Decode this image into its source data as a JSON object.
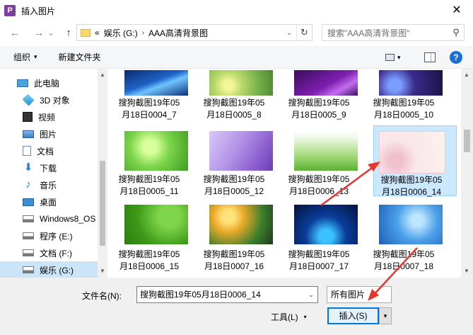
{
  "window": {
    "title": "插入图片",
    "app_icon": "P",
    "close_glyph": "✕"
  },
  "nav": {
    "back_glyph": "←",
    "forward_glyph": "→",
    "history_glyph": "⌄",
    "up_glyph": "↑",
    "address": {
      "overflow": "«",
      "segments": [
        "娱乐 (G:)",
        "AAA高清背景图"
      ],
      "chevron": "›",
      "dropdown": "⌄",
      "refresh": "↻"
    },
    "search_placeholder": "搜索\"AAA高清背景图\"",
    "search_glyph": "⚲"
  },
  "toolbar": {
    "organize": "组织",
    "new_folder": "新建文件夹",
    "caret": "▾",
    "help": "?"
  },
  "sidebar": {
    "items": [
      {
        "label": "此电脑",
        "icon": "computer-icon"
      },
      {
        "label": "3D 对象",
        "icon": "3d-objects-icon"
      },
      {
        "label": "视频",
        "icon": "video-icon"
      },
      {
        "label": "图片",
        "icon": "pictures-icon"
      },
      {
        "label": "文档",
        "icon": "documents-icon"
      },
      {
        "label": "下载",
        "icon": "download-icon"
      },
      {
        "label": "音乐",
        "icon": "music-icon"
      },
      {
        "label": "桌面",
        "icon": "desktop-icon"
      },
      {
        "label": "Windows8_OS",
        "icon": "drive-icon"
      },
      {
        "label": "程序 (E:)",
        "icon": "drive-icon"
      },
      {
        "label": "文档 (F:)",
        "icon": "drive-icon"
      },
      {
        "label": "娱乐 (G:)",
        "icon": "drive-icon",
        "selected": true
      }
    ]
  },
  "files": [
    {
      "line1": "搜狗截图19年05",
      "line2": "月18日0004_7"
    },
    {
      "line1": "搜狗截图19年05",
      "line2": "月18日0005_8"
    },
    {
      "line1": "搜狗截图19年05",
      "line2": "月18日0005_9"
    },
    {
      "line1": "搜狗截图19年05",
      "line2": "月18日0005_10"
    },
    {
      "line1": "搜狗截图19年05",
      "line2": "月18日0005_11"
    },
    {
      "line1": "搜狗截图19年05",
      "line2": "月18日0005_12"
    },
    {
      "line1": "搜狗截图19年05",
      "line2": "月18日0006_13"
    },
    {
      "line1": "搜狗截图19年05",
      "line2": "月18日0006_14",
      "selected": true
    },
    {
      "line1": "搜狗截图19年05",
      "line2": "月18日0006_15"
    },
    {
      "line1": "搜狗截图19年05",
      "line2": "月18日0007_16"
    },
    {
      "line1": "搜狗截图19年05",
      "line2": "月18日0007_17"
    },
    {
      "line1": "搜狗截图19年05",
      "line2": "月18日0007_18"
    }
  ],
  "bottom": {
    "filename_label": "文件名(N):",
    "filename_value": "搜狗截图19年05月18日0006_14",
    "filter": "所有图片",
    "tools": "工具(L)",
    "insert": "插入(S)",
    "dropdown": "▾"
  },
  "colors": {
    "accent": "#0078d7",
    "selection": "#cce8ff",
    "annotation_arrow": "#e8352e"
  }
}
